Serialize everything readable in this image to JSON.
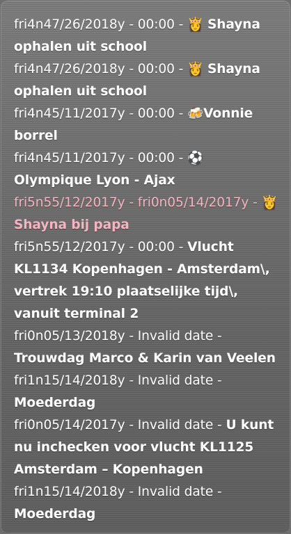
{
  "events": [
    {
      "when": "fri4n47/26/2018y - 00:00 - ",
      "emoji": "👸",
      "title": "Shayna ophalen uit school",
      "highlight": false
    },
    {
      "when": "fri4n47/26/2018y - 00:00 - ",
      "emoji": "👸",
      "title": "Shayna ophalen uit school",
      "highlight": false
    },
    {
      "when": "fri4n45/11/2017y - 00:00 - ",
      "emoji": "🍻",
      "title": "Vonnie borrel",
      "highlight": false
    },
    {
      "when": "fri4n45/11/2017y - 00:00 - ",
      "emoji": "⚽",
      "title": "Olympique Lyon - Ajax",
      "highlight": false
    },
    {
      "when": "fri5n55/12/2017y - fri0n05/14/2017y - ",
      "emoji": "👸",
      "title": "Shayna bij papa",
      "highlight": true
    },
    {
      "when": "fri5n55/12/2017y - 00:00 - ",
      "emoji": "",
      "title": "Vlucht KL1134 Kopenhagen - Amsterdam\\, vertrek 19:10 plaatselijke tijd\\, vanuit terminal 2",
      "highlight": false
    },
    {
      "when": "fri0n05/13/2018y - Invalid date - ",
      "emoji": "",
      "title": "Trouwdag Marco & Karin van Veelen",
      "highlight": false
    },
    {
      "when": "fri1n15/14/2018y - Invalid date - ",
      "emoji": "",
      "title": "Moederdag",
      "highlight": false
    },
    {
      "when": "fri0n05/14/2017y - Invalid date - ",
      "emoji": "",
      "title": "U kunt nu inchecken voor vlucht KL1125 Amsterdam – Kopenhagen",
      "highlight": false
    },
    {
      "when": "fri1n15/14/2018y - Invalid date - ",
      "emoji": "",
      "title": "Moederdag",
      "highlight": false
    }
  ]
}
